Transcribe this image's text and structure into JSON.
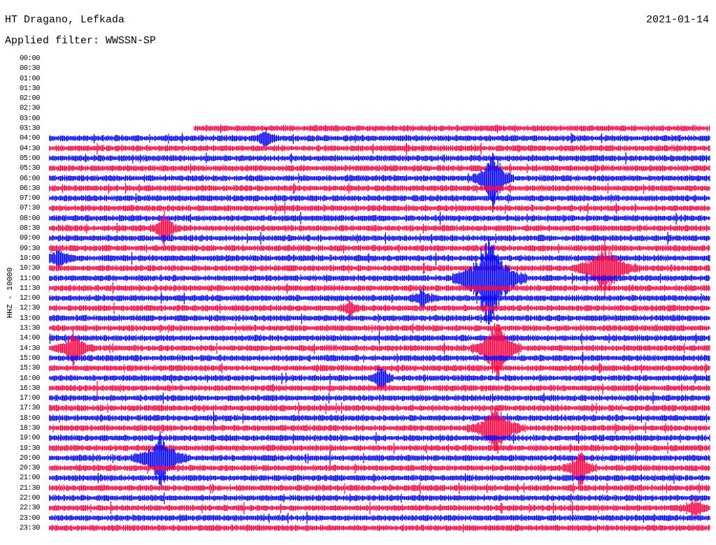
{
  "header": {
    "station": "HT Dragano, Lefkada",
    "date": "2021-01-14",
    "filter": "Applied filter: WWSSN-SP"
  },
  "axis_label": "HHZ - 10000",
  "rows": [
    {
      "time": "00:00",
      "kind": "empty"
    },
    {
      "time": "00:30",
      "kind": "empty"
    },
    {
      "time": "01:00",
      "kind": "empty"
    },
    {
      "time": "01:30",
      "kind": "empty"
    },
    {
      "time": "02:00",
      "kind": "empty"
    },
    {
      "time": "02:30",
      "kind": "empty"
    },
    {
      "time": "03:00",
      "kind": "empty"
    },
    {
      "time": "03:30",
      "kind": "partial",
      "color": "#ff0040"
    },
    {
      "time": "04:00",
      "kind": "full",
      "color": "#0000ff"
    },
    {
      "time": "04:30",
      "kind": "full",
      "color": "#ff0040"
    },
    {
      "time": "05:00",
      "kind": "full",
      "color": "#0000ff"
    },
    {
      "time": "05:30",
      "kind": "full",
      "color": "#ff0040"
    },
    {
      "time": "06:00",
      "kind": "full",
      "color": "#0000ff"
    },
    {
      "time": "06:30",
      "kind": "full",
      "color": "#ff0040"
    },
    {
      "time": "07:00",
      "kind": "full",
      "color": "#0000ff"
    },
    {
      "time": "07:30",
      "kind": "full",
      "color": "#ff0040"
    },
    {
      "time": "08:00",
      "kind": "full",
      "color": "#0000ff"
    },
    {
      "time": "08:30",
      "kind": "full",
      "color": "#ff0040"
    },
    {
      "time": "09:00",
      "kind": "full",
      "color": "#0000ff"
    },
    {
      "time": "09:30",
      "kind": "full",
      "color": "#ff0040"
    },
    {
      "time": "10:00",
      "kind": "full",
      "color": "#0000ff"
    },
    {
      "time": "10:30",
      "kind": "full",
      "color": "#ff0040"
    },
    {
      "time": "11:00",
      "kind": "full",
      "color": "#0000ff"
    },
    {
      "time": "11:30",
      "kind": "full",
      "color": "#ff0040"
    },
    {
      "time": "12:00",
      "kind": "full",
      "color": "#0000ff"
    },
    {
      "time": "12:30",
      "kind": "full",
      "color": "#ff0040"
    },
    {
      "time": "13:00",
      "kind": "full",
      "color": "#0000ff"
    },
    {
      "time": "13:30",
      "kind": "full",
      "color": "#ff0040"
    },
    {
      "time": "14:00",
      "kind": "full",
      "color": "#0000ff"
    },
    {
      "time": "14:30",
      "kind": "full",
      "color": "#ff0040"
    },
    {
      "time": "15:00",
      "kind": "full",
      "color": "#0000ff"
    },
    {
      "time": "15:30",
      "kind": "full",
      "color": "#ff0040"
    },
    {
      "time": "16:00",
      "kind": "full",
      "color": "#0000ff"
    },
    {
      "time": "16:30",
      "kind": "full",
      "color": "#ff0040"
    },
    {
      "time": "17:00",
      "kind": "full",
      "color": "#0000ff"
    },
    {
      "time": "17:30",
      "kind": "full",
      "color": "#ff0040"
    },
    {
      "time": "18:00",
      "kind": "full",
      "color": "#0000ff"
    },
    {
      "time": "18:30",
      "kind": "full",
      "color": "#ff0040"
    },
    {
      "time": "19:00",
      "kind": "full",
      "color": "#0000ff"
    },
    {
      "time": "19:30",
      "kind": "full",
      "color": "#ff0040"
    },
    {
      "time": "20:00",
      "kind": "full",
      "color": "#0000ff"
    },
    {
      "time": "20:30",
      "kind": "full",
      "color": "#ff0040"
    },
    {
      "time": "21:00",
      "kind": "full",
      "color": "#0000ff"
    },
    {
      "time": "21:30",
      "kind": "full",
      "color": "#ff0040"
    },
    {
      "time": "22:00",
      "kind": "full",
      "color": "#0000ff"
    },
    {
      "time": "22:30",
      "kind": "full",
      "color": "#ff0040"
    },
    {
      "time": "23:00",
      "kind": "full",
      "color": "#0000ff"
    },
    {
      "time": "23:30",
      "kind": "full",
      "color": "#ff0040"
    }
  ]
}
